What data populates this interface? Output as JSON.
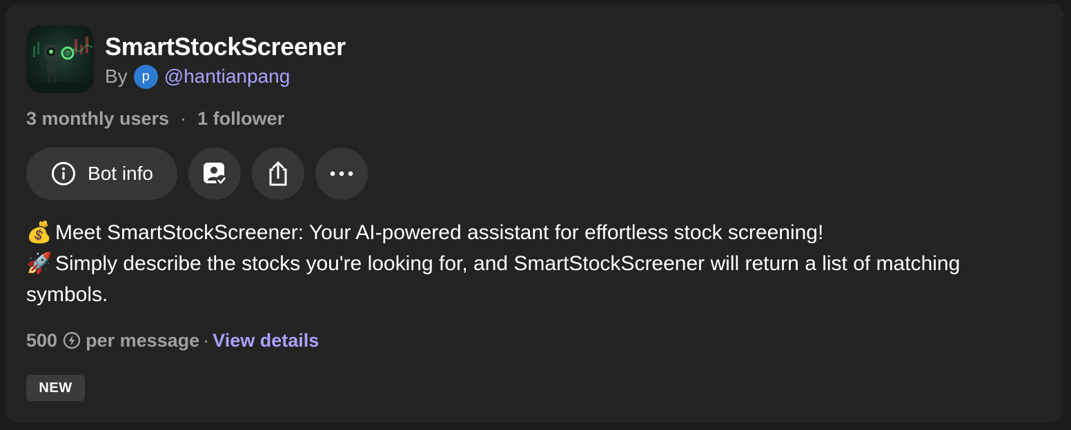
{
  "bot": {
    "name": "SmartStockScreener",
    "by_label": "By",
    "author_initial": "p",
    "author_handle": "@hantianpang",
    "avatar_icon": "robot-trader-avatar"
  },
  "stats": {
    "monthly_users": "3 monthly users",
    "separator": "·",
    "followers": "1 follower"
  },
  "actions": {
    "bot_info_label": "Bot info",
    "bot_info_icon": "info-circle-icon",
    "follow_icon": "person-check-icon",
    "share_icon": "share-icon",
    "more_icon": "more-dots-icon"
  },
  "description": {
    "line1_emoji": "💰",
    "line1_text": "Meet SmartStockScreener: Your AI-powered assistant for effortless stock screening!",
    "line2_emoji": "🚀",
    "line2_text": "Simply describe the stocks you're looking for, and SmartStockScreener will return a list of matching symbols."
  },
  "pricing": {
    "amount": "500",
    "unit_icon": "compute-points-icon",
    "per_label": "per message",
    "separator": "·",
    "details_link": "View details"
  },
  "badge": {
    "label": "NEW"
  },
  "colors": {
    "card_background": "#232323",
    "button_background": "#353636",
    "accent_link": "#a9a3ff",
    "author_avatar": "#2f7ad1",
    "muted_text": "#a0a0a0"
  }
}
